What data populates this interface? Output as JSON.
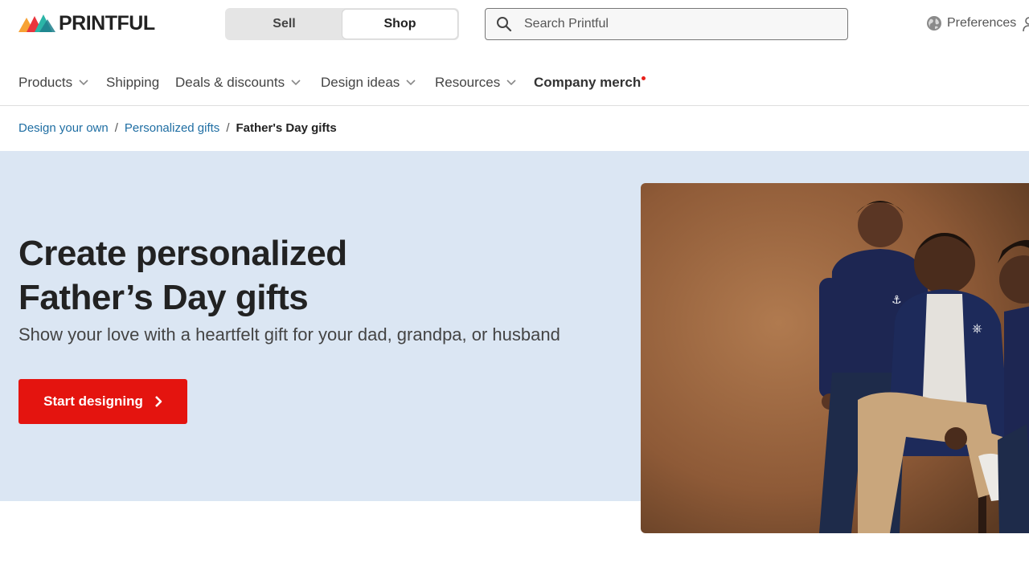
{
  "brand": {
    "name": "PRINTFUL"
  },
  "mode_toggle": {
    "sell_label": "Sell",
    "shop_label": "Shop",
    "selected": "Shop"
  },
  "search": {
    "placeholder": "Search Printful",
    "value": ""
  },
  "header": {
    "preferences_label": "Preferences"
  },
  "nav": {
    "items": [
      {
        "label": "Products",
        "has_dropdown": true
      },
      {
        "label": "Shipping",
        "has_dropdown": false
      },
      {
        "label": "Deals & discounts",
        "has_dropdown": true
      },
      {
        "label": "Design ideas",
        "has_dropdown": true
      },
      {
        "label": "Resources",
        "has_dropdown": true
      },
      {
        "label": "Company merch",
        "has_dropdown": false,
        "badge": "new-dot"
      }
    ]
  },
  "breadcrumb": [
    {
      "label": "Design your own"
    },
    {
      "label": "Personalized gifts"
    },
    {
      "label": "Father's Day gifts"
    }
  ],
  "hero": {
    "title_line1": "Create personalized",
    "title_line2": "Father’s Day gifts",
    "subtitle": "Show your love with a heartfelt gift for your dad, grandpa, or husband",
    "cta_label": "Start designing",
    "image_alt": ""
  },
  "colors": {
    "accent_red": "#e4140f",
    "hero_bg": "#dbe6f3",
    "link_blue": "#1f6ea3"
  },
  "icons": [
    "printful-logo-icon",
    "search-icon",
    "globe-icon",
    "user-icon",
    "chevron-down-icon",
    "chevron-right-icon"
  ]
}
